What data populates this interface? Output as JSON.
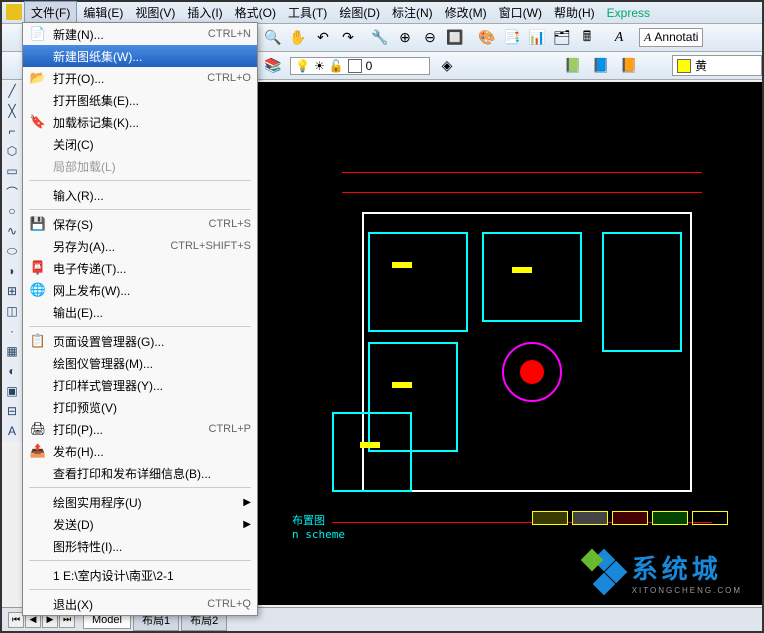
{
  "menubar": {
    "items": [
      {
        "label": "文件(F)",
        "active": true
      },
      {
        "label": "编辑(E)"
      },
      {
        "label": "视图(V)"
      },
      {
        "label": "插入(I)"
      },
      {
        "label": "格式(O)"
      },
      {
        "label": "工具(T)"
      },
      {
        "label": "绘图(D)"
      },
      {
        "label": "标注(N)"
      },
      {
        "label": "修改(M)"
      },
      {
        "label": "窗口(W)"
      },
      {
        "label": "帮助(H)"
      },
      {
        "label": "Express",
        "cls": "express"
      }
    ]
  },
  "dropdown": {
    "groups": [
      [
        {
          "icon": "📄",
          "label": "新建(N)...",
          "shortcut": "CTRL+N"
        },
        {
          "icon": "",
          "label": "新建图纸集(W)...",
          "highlighted": true
        },
        {
          "icon": "📂",
          "label": "打开(O)...",
          "shortcut": "CTRL+O"
        },
        {
          "icon": "",
          "label": "打开图纸集(E)..."
        },
        {
          "icon": "🔖",
          "label": "加载标记集(K)..."
        },
        {
          "icon": "",
          "label": "关闭(C)"
        },
        {
          "icon": "",
          "label": "局部加载(L)",
          "disabled": true
        }
      ],
      [
        {
          "icon": "",
          "label": "输入(R)..."
        }
      ],
      [
        {
          "icon": "💾",
          "label": "保存(S)",
          "shortcut": "CTRL+S"
        },
        {
          "icon": "",
          "label": "另存为(A)...",
          "shortcut": "CTRL+SHIFT+S"
        },
        {
          "icon": "📮",
          "label": "电子传递(T)..."
        },
        {
          "icon": "🌐",
          "label": "网上发布(W)..."
        },
        {
          "icon": "",
          "label": "输出(E)..."
        }
      ],
      [
        {
          "icon": "📋",
          "label": "页面设置管理器(G)..."
        },
        {
          "icon": "",
          "label": "绘图仪管理器(M)..."
        },
        {
          "icon": "",
          "label": "打印样式管理器(Y)..."
        },
        {
          "icon": "",
          "label": "打印预览(V)"
        },
        {
          "icon": "🖨",
          "label": "打印(P)...",
          "shortcut": "CTRL+P",
          "redbox": true
        },
        {
          "icon": "📤",
          "label": "发布(H)..."
        },
        {
          "icon": "",
          "label": "查看打印和发布详细信息(B)..."
        }
      ],
      [
        {
          "icon": "",
          "label": "绘图实用程序(U)",
          "arrow": true
        },
        {
          "icon": "",
          "label": "发送(D)",
          "arrow": true
        },
        {
          "icon": "",
          "label": "图形特性(I)..."
        }
      ],
      [
        {
          "icon": "",
          "label": "1 E:\\室内设计\\南亚\\2-1"
        }
      ],
      [
        {
          "icon": "",
          "label": "退出(X)",
          "shortcut": "CTRL+Q"
        }
      ]
    ]
  },
  "toolbar2": {
    "layer_value": "0",
    "color_label": "黄"
  },
  "annot_label": "Annotati",
  "canvas": {
    "label1": "布置图",
    "label2": "n  scheme"
  },
  "tabs": {
    "items": [
      "Model",
      "布局1",
      "布局2"
    ]
  },
  "watermark": {
    "text": "系统城",
    "sub": "XITONGCHENG.COM"
  }
}
